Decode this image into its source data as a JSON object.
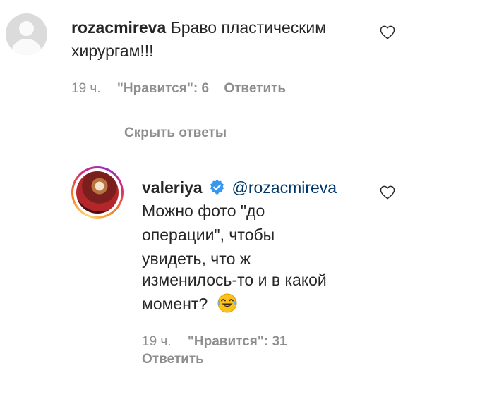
{
  "comments": [
    {
      "username": "rozacmireva",
      "text_line1": "Браво пластическим",
      "text_line2": "хирургам!!!",
      "time": "19 ч.",
      "likes": "\"Нравится\": 6",
      "reply_label": "Ответить"
    }
  ],
  "hide_replies_label": "Скрыть ответы",
  "replies": [
    {
      "username": "valeriya",
      "mention": "@rozacmireva",
      "text_lines": [
        "Можно фото \"до",
        "операции\", чтобы",
        "увидеть, что ж",
        "изменилось-то и в какой",
        "момент?"
      ],
      "emoji": "laughing-tears",
      "time": "19 ч.",
      "likes": "\"Нравится\": 31",
      "reply_label": "Ответить"
    }
  ],
  "colors": {
    "text": "#262626",
    "secondary": "#8e8e8e",
    "mention": "#00376b",
    "verified": "#3897f0"
  }
}
